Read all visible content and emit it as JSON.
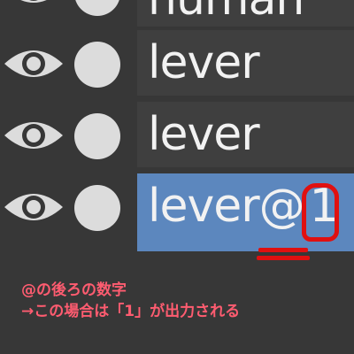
{
  "layers": [
    {
      "name": "human"
    },
    {
      "name": "lever"
    },
    {
      "name": "lever"
    },
    {
      "name_prefix": "lever",
      "name_at": "@",
      "name_number": "1",
      "selected": true
    }
  ],
  "icons": {
    "visibility": "eye-icon",
    "dot": "circle-icon"
  },
  "colors": {
    "selected_row": "#5c87be",
    "annotation": "#e01010",
    "note_text": "#ff5c70"
  },
  "annotation": {
    "line1": "@の後ろの数字",
    "line2": "→この場合は「1」が出力される"
  }
}
